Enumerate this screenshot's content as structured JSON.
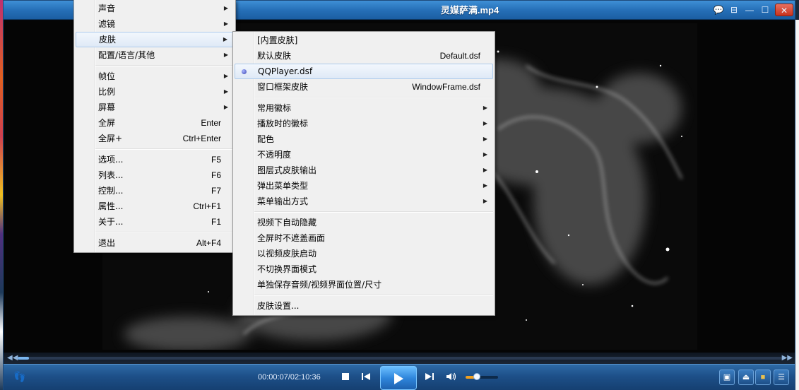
{
  "window": {
    "title": "灵媒萨满.mp4"
  },
  "titlebar_buttons": [
    {
      "name": "chat-icon",
      "glyph": "💬"
    },
    {
      "name": "compact-mode-icon",
      "glyph": "⊟"
    },
    {
      "name": "minimize-icon",
      "glyph": "—"
    },
    {
      "name": "maximize-icon",
      "glyph": "☐"
    },
    {
      "name": "close-icon",
      "glyph": "✕"
    }
  ],
  "main_menu": {
    "items": [
      {
        "label": "声音",
        "shortcut": "",
        "submenu": true
      },
      {
        "label": "滤镜",
        "shortcut": "",
        "submenu": true
      },
      {
        "label": "皮肤",
        "shortcut": "",
        "submenu": true,
        "highlighted": true
      },
      {
        "label": "配置/语言/其他",
        "shortcut": "",
        "submenu": true
      },
      {
        "label": "帧位",
        "shortcut": "",
        "submenu": true
      },
      {
        "label": "比例",
        "shortcut": "",
        "submenu": true
      },
      {
        "label": "屏幕",
        "shortcut": "",
        "submenu": true
      },
      {
        "label": "全屏",
        "shortcut": "Enter",
        "submenu": false
      },
      {
        "label": "全屏+",
        "shortcut": "Ctrl+Enter",
        "submenu": false
      },
      {
        "label": "选项...",
        "shortcut": "F5",
        "submenu": false
      },
      {
        "label": "列表...",
        "shortcut": "F6",
        "submenu": false
      },
      {
        "label": "控制...",
        "shortcut": "F7",
        "submenu": false
      },
      {
        "label": "属性...",
        "shortcut": "Ctrl+F1",
        "submenu": false
      },
      {
        "label": "关于...",
        "shortcut": "F1",
        "submenu": false
      },
      {
        "label": "退出",
        "shortcut": "Alt+F4",
        "submenu": false
      }
    ]
  },
  "skin_menu": {
    "items": [
      {
        "label": "[内置皮肤]",
        "shortcut": "",
        "submenu": false
      },
      {
        "label": "默认皮肤",
        "shortcut": "Default.dsf",
        "submenu": false
      },
      {
        "label": "QQPlayer.dsf",
        "shortcut": "",
        "submenu": false,
        "selected": true,
        "highlighted": true
      },
      {
        "label": "窗口框架皮肤",
        "shortcut": "WindowFrame.dsf",
        "submenu": false
      },
      {
        "label": "常用徽标",
        "shortcut": "",
        "submenu": true
      },
      {
        "label": "播放时的徽标",
        "shortcut": "",
        "submenu": true
      },
      {
        "label": "配色",
        "shortcut": "",
        "submenu": true
      },
      {
        "label": "不透明度",
        "shortcut": "",
        "submenu": true
      },
      {
        "label": "图层式皮肤输出",
        "shortcut": "",
        "submenu": true
      },
      {
        "label": "弹出菜单类型",
        "shortcut": "",
        "submenu": true
      },
      {
        "label": "菜单输出方式",
        "shortcut": "",
        "submenu": true
      },
      {
        "label": "视频下自动隐藏",
        "shortcut": "",
        "submenu": false
      },
      {
        "label": "全屏时不遮盖画面",
        "shortcut": "",
        "submenu": false
      },
      {
        "label": "以视频皮肤启动",
        "shortcut": "",
        "submenu": false
      },
      {
        "label": "不切换界面模式",
        "shortcut": "",
        "submenu": false
      },
      {
        "label": "单独保存音频/视频界面位置/尺寸",
        "shortcut": "",
        "submenu": false
      },
      {
        "label": "皮肤设置...",
        "shortcut": "",
        "submenu": false
      }
    ]
  },
  "playback": {
    "time": "00:00:07/02:10:36",
    "progress": 0.015,
    "volume": 0.35
  },
  "controls": [
    {
      "name": "stop-icon"
    },
    {
      "name": "previous-icon"
    },
    {
      "name": "play-icon"
    },
    {
      "name": "next-icon"
    },
    {
      "name": "volume-icon"
    }
  ],
  "right_buttons": [
    {
      "name": "screenshot-icon",
      "glyph": "▣"
    },
    {
      "name": "eject-icon",
      "glyph": "⏏"
    },
    {
      "name": "color-settings-icon",
      "glyph": "■"
    },
    {
      "name": "playlist-icon",
      "glyph": "☰"
    }
  ],
  "colors": {
    "titlebar": "#2670b8",
    "controlbar": "#1d4f88",
    "menu_bg": "#f0f0f0",
    "highlight": "#dfe9f6",
    "play_button": "#2f86dc"
  }
}
